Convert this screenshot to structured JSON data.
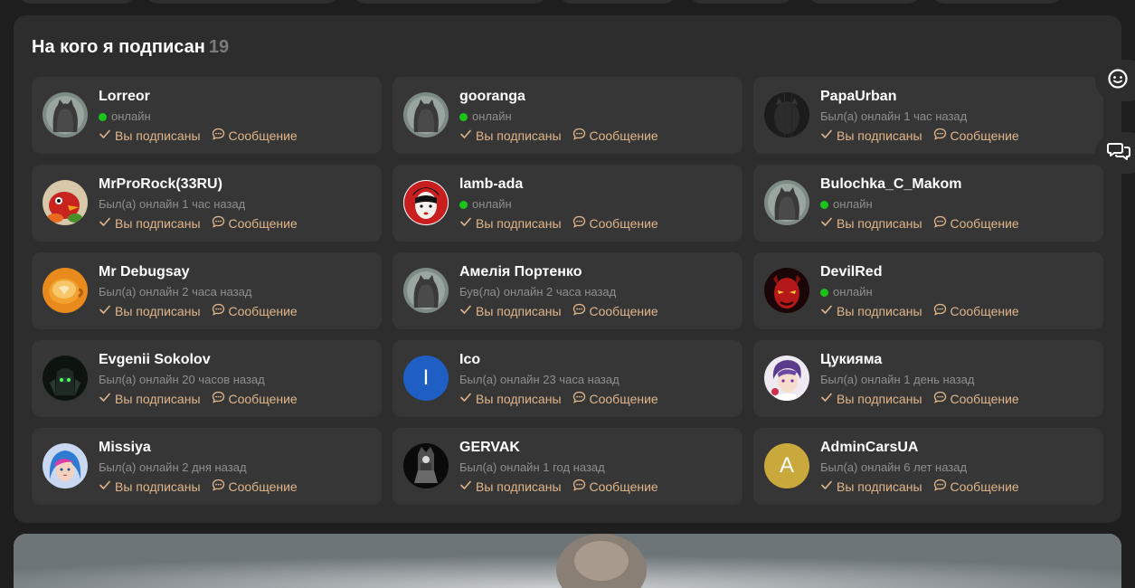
{
  "colors": {
    "background": "#1e1e1e",
    "panel": "#2d2d2d",
    "card": "#363636",
    "accent_action": "#e0b58a",
    "online_dot": "#1bc41b",
    "muted_text": "#8f8f8f"
  },
  "following": {
    "title": "На кого я подписан",
    "count": "19",
    "subscribed_label": "Вы подписаны",
    "message_label": "Сообщение",
    "users": [
      {
        "name": "Lorreor",
        "status": "онлайн",
        "online": true,
        "avatar": "cat-placeholder"
      },
      {
        "name": "gooranga",
        "status": "онлайн",
        "online": true,
        "avatar": "cat-placeholder"
      },
      {
        "name": "PapaUrban",
        "status": "Был(а) онлайн 1 час назад",
        "online": false,
        "avatar": "dark-cat"
      },
      {
        "name": "MrProRock(33RU)",
        "status": "Был(а) онлайн 1 час назад",
        "online": false,
        "avatar": "red-bird"
      },
      {
        "name": "lamb-ada",
        "status": "онлайн",
        "online": true,
        "avatar": "geisha"
      },
      {
        "name": "Bulochka_C_Makom",
        "status": "онлайн",
        "online": true,
        "avatar": "cat-placeholder"
      },
      {
        "name": "Mr Debugsay",
        "status": "Был(а) онлайн 2 часа назад",
        "online": false,
        "avatar": "coffee-cup"
      },
      {
        "name": "Амелія Портенко",
        "status": "Був(ла) онлайн 2 часа назад",
        "online": false,
        "avatar": "cat-placeholder"
      },
      {
        "name": "DevilRed",
        "status": "онлайн",
        "online": true,
        "avatar": "red-devil"
      },
      {
        "name": "Evgenii Sokolov",
        "status": "Был(а) онлайн 20 часов назад",
        "online": false,
        "avatar": "green-robot"
      },
      {
        "name": "Ico",
        "status": "Был(а) онлайн 23 часа назад",
        "online": false,
        "avatar": "letter",
        "letter": "I",
        "avatar_color": "#1f5fc4"
      },
      {
        "name": "Цукияма",
        "status": "Был(а) онлайн 1 день назад",
        "online": false,
        "avatar": "anime-purple"
      },
      {
        "name": "Missiya",
        "status": "Был(а) онлайн 2 дня назад",
        "online": false,
        "avatar": "blue-hair-girl"
      },
      {
        "name": "GERVAK",
        "status": "Был(а) онлайн 1 год назад",
        "online": false,
        "avatar": "throne"
      },
      {
        "name": "AdminCarsUA",
        "status": "Был(а) онлайн 6 лет назад",
        "online": false,
        "avatar": "letter",
        "letter": "A",
        "avatar_color": "#c9a83c"
      }
    ]
  },
  "side_buttons": [
    "chat-icon",
    "comments-icon"
  ]
}
